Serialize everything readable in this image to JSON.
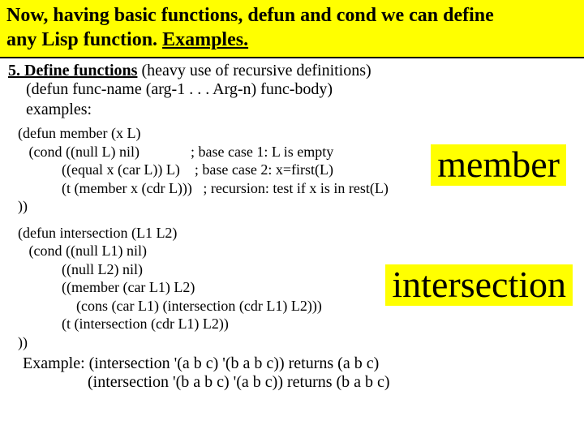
{
  "header": {
    "line1": "Now, having basic functions, defun and cond we can define",
    "line2_prefix": "any Lisp function. ",
    "line2_link": "Examples."
  },
  "section": {
    "number_label": "5. Define functions",
    "paren": "  (heavy use of recursive definitions)",
    "defun_syntax": "(defun func-name (arg-1 . . . Arg-n) func-body)",
    "examples_label": "examples:"
  },
  "member_code": {
    "l1": "(defun member (x L)",
    "l2a": "   (cond ((null L) nil)              ",
    "l2b": "; base case 1: L is empty",
    "l3a": "            ((equal x (car L)) L)    ",
    "l3b": "; base case 2: x=first(L)",
    "l4a": "            (t (member x (cdr L)))   ",
    "l4b": "; recursion: test if x is in rest(L)",
    "l5": "))"
  },
  "intersection_code": {
    "l1": "(defun intersection (L1 L2)",
    "l2": "   (cond ((null L1) nil)",
    "l3": "            ((null L2) nil)",
    "l4": "            ((member (car L1) L2)",
    "l5": "                (cons (car L1) (intersection (cdr L1) L2)))",
    "l6": "            (t (intersection (cdr L1) L2))",
    "l7": "))"
  },
  "example_out": {
    "l1": "Example: (intersection '(a b c) '(b a b c)) returns (a b c)",
    "l2": "(intersection '(b a b c) '(a b c)) returns (b a b c)"
  },
  "badges": {
    "member": "member",
    "intersection": "intersection"
  }
}
